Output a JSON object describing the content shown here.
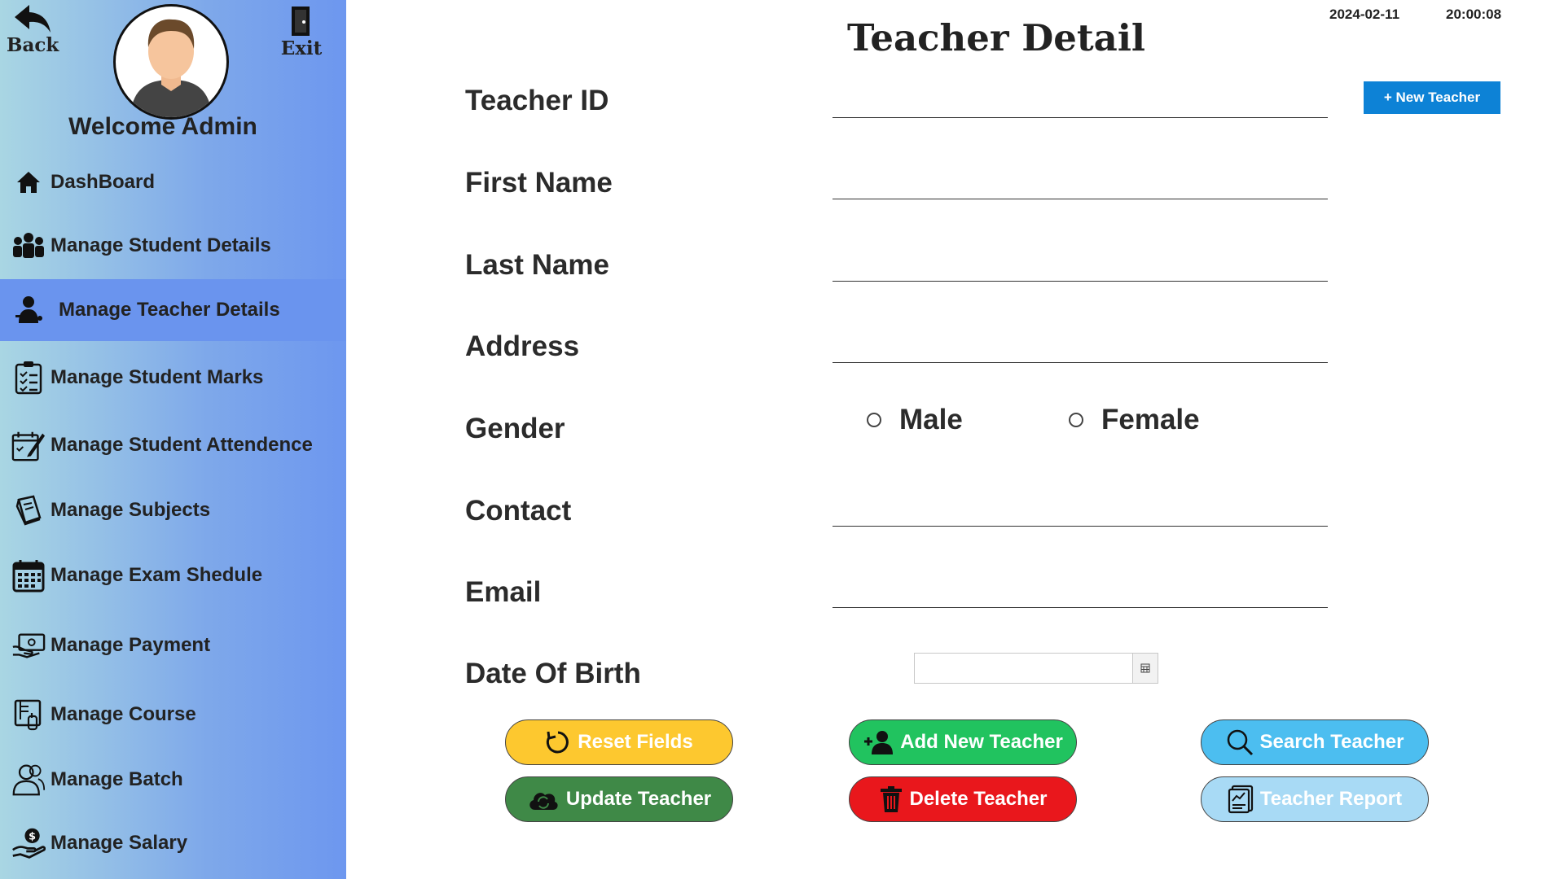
{
  "sidebar": {
    "back_label": "Back",
    "exit_label": "Exit",
    "welcome": "Welcome Admin",
    "items": [
      {
        "label": "DashBoard",
        "icon": "home-icon"
      },
      {
        "label": "Manage Student Details",
        "icon": "group-icon"
      },
      {
        "label": "Manage Teacher Details",
        "icon": "teacher-icon",
        "active": true
      },
      {
        "label": "Manage Student Marks",
        "icon": "checklist-icon"
      },
      {
        "label": "Manage Student Attendence",
        "icon": "attendance-icon"
      },
      {
        "label": "Manage Subjects",
        "icon": "book-icon"
      },
      {
        "label": "Manage Exam Shedule",
        "icon": "calendar-icon"
      },
      {
        "label": "Manage Payment",
        "icon": "payment-icon"
      },
      {
        "label": "Manage Course",
        "icon": "course-icon"
      },
      {
        "label": "Manage Batch",
        "icon": "users-icon"
      },
      {
        "label": "Manage Salary",
        "icon": "salary-icon"
      }
    ]
  },
  "header": {
    "title": "Teacher Detail",
    "date": "2024-02-11",
    "time": "20:00:08",
    "new_button": "+ New Teacher"
  },
  "form": {
    "teacher_id_label": "Teacher ID",
    "first_name_label": "First Name",
    "last_name_label": "Last Name",
    "address_label": "Address",
    "gender_label": "Gender",
    "gender_options": [
      "Male",
      "Female"
    ],
    "contact_label": "Contact",
    "email_label": "Email",
    "dob_label": "Date Of Birth",
    "teacher_id_value": "",
    "first_name_value": "",
    "last_name_value": "",
    "address_value": "",
    "contact_value": "",
    "email_value": "",
    "dob_value": ""
  },
  "actions": {
    "reset": "Reset Fields",
    "add": "Add New Teacher",
    "search": "Search Teacher",
    "update": "Update Teacher",
    "delete": "Delete Teacher",
    "report": "Teacher Report"
  },
  "colors": {
    "reset": "#fdc82f",
    "add": "#21c35f",
    "search": "#4cbef0",
    "update": "#3f8947",
    "delete": "#e9171c",
    "report": "#a8daf5",
    "new_button": "#0d82d6",
    "sidebar_active": "#6a94ee"
  }
}
